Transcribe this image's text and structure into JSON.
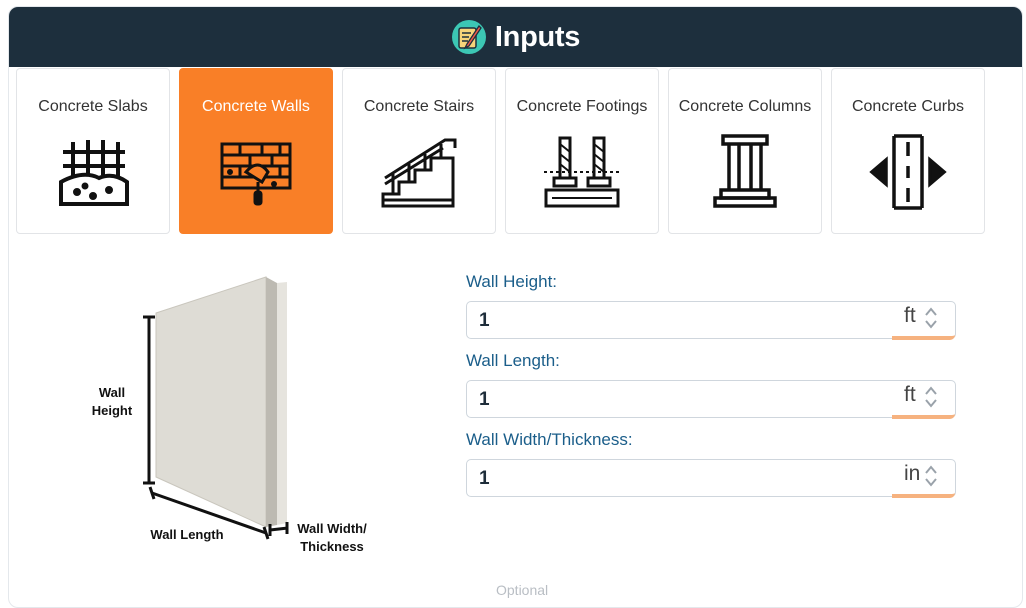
{
  "header": {
    "title": "Inputs",
    "logo_icon": "pencil-ruler-icon"
  },
  "tabs": [
    {
      "label": "Concrete Slabs",
      "icon": "slab-icon",
      "active": false
    },
    {
      "label": "Concrete Walls",
      "icon": "wall-trowel-icon",
      "active": true
    },
    {
      "label": "Concrete Stairs",
      "icon": "stairs-icon",
      "active": false
    },
    {
      "label": "Concrete Footings",
      "icon": "footing-icon",
      "active": false
    },
    {
      "label": "Concrete Columns",
      "icon": "column-icon",
      "active": false
    },
    {
      "label": "Concrete Curbs",
      "icon": "curb-icon",
      "active": false
    }
  ],
  "diagram": {
    "height_label_line1": "Wall",
    "height_label_line2": "Height",
    "length_label": "Wall Length",
    "width_label_line1": "Wall Width/",
    "width_label_line2": "Thickness"
  },
  "fields": [
    {
      "label": "Wall Height:",
      "value": "1",
      "unit": "ft"
    },
    {
      "label": "Wall Length:",
      "value": "1",
      "unit": "ft"
    },
    {
      "label": "Wall Width/Thickness:",
      "value": "1",
      "unit": "in"
    }
  ],
  "footer_hint": "Optional",
  "colors": {
    "header_bg": "#1d2f3d",
    "accent": "#f97f27",
    "label": "#1b5e8a",
    "unit_underline": "#f6b27f"
  }
}
